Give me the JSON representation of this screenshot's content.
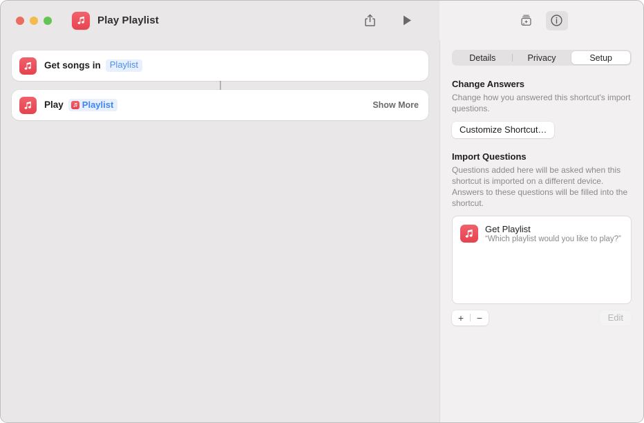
{
  "window": {
    "title": "Play Playlist",
    "app_icon": "music-note-icon",
    "traffic_lights": [
      "close-button",
      "minimize-button",
      "zoom-button"
    ],
    "accent_red": "#e6424e",
    "accent_blue": "#3f86f2"
  },
  "toolbar": {
    "share_label": "share-icon",
    "run_label": "play-icon",
    "add_action_label": "add-shortcut-icon",
    "info_label": "info-icon"
  },
  "canvas": {
    "actions": [
      {
        "icon": "music-note-icon",
        "text": "Get songs in",
        "token": "Playlist",
        "token_type": "plain",
        "show_more": ""
      },
      {
        "icon": "music-note-icon",
        "text": "Play",
        "token": "Playlist",
        "token_type": "variable",
        "show_more": "Show More"
      }
    ]
  },
  "inspector": {
    "tabs": [
      {
        "label": "Details",
        "active": false
      },
      {
        "label": "Privacy",
        "active": false
      },
      {
        "label": "Setup",
        "active": true
      }
    ],
    "change_answers": {
      "title": "Change Answers",
      "description": "Change how you answered this shortcut's import questions.",
      "button": "Customize Shortcut…"
    },
    "import_questions": {
      "title": "Import Questions",
      "description": "Questions added here will be asked when this shortcut is imported on a different device. Answers to these questions will be filled into the shortcut.",
      "items": [
        {
          "icon": "music-note-icon",
          "title": "Get Playlist",
          "prompt": "“Which playlist would you like to play?”"
        }
      ],
      "add_label": "+",
      "remove_label": "−",
      "edit_label": "Edit"
    }
  }
}
